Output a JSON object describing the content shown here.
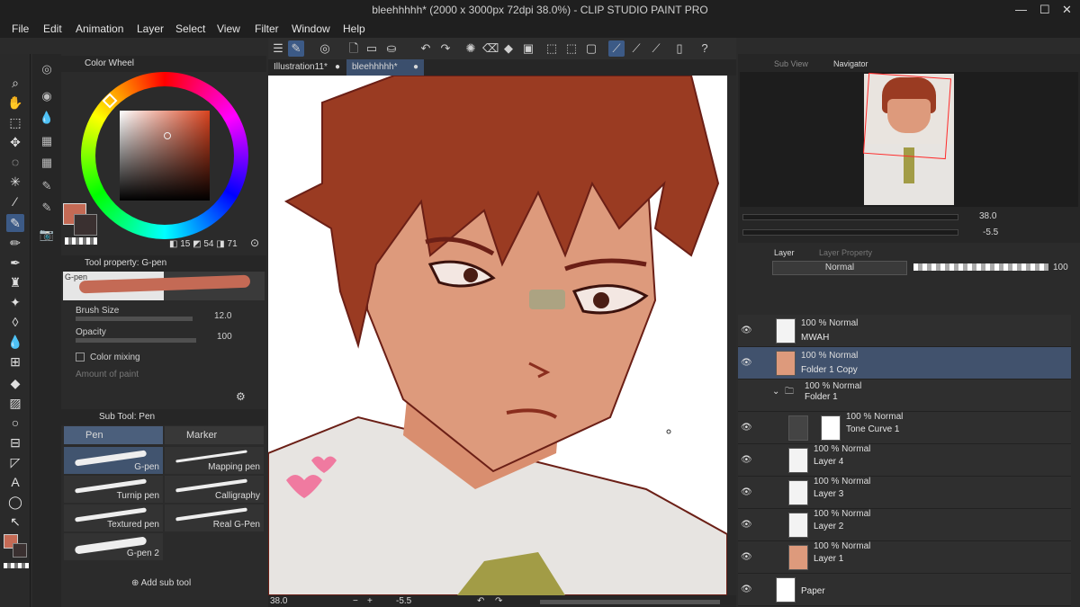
{
  "window": {
    "title": "bleehhhhh* (2000 x 3000px 72dpi 38.0%) - CLIP STUDIO PAINT PRO",
    "minimize": "—",
    "maximize": "☐",
    "close": "✕"
  },
  "menu": [
    "File",
    "Edit",
    "Animation",
    "Layer",
    "Select",
    "View",
    "Filter",
    "Window",
    "Help"
  ],
  "tabs": [
    {
      "label": "Illustration11*"
    },
    {
      "label": "bleehhhhh*"
    }
  ],
  "color_wheel": {
    "title": "Color Wheel",
    "h": "15",
    "s": "54",
    "v": "71",
    "main_color": "#c46a55",
    "sub_color": "#3a3030"
  },
  "tool_property": {
    "title": "Tool property: G-pen",
    "preview_label": "G-pen",
    "brush_size_label": "Brush Size",
    "brush_size_value": "12.0",
    "opacity_label": "Opacity",
    "opacity_value": "100",
    "color_mixing_label": "Color mixing",
    "amount_of_paint_label": "Amount of paint"
  },
  "sub_tool": {
    "title": "Sub Tool: Pen",
    "groups": [
      "Pen",
      "Marker"
    ],
    "items": [
      "G-pen",
      "Mapping pen",
      "Turnip pen",
      "Calligraphy",
      "Textured pen",
      "Real G-Pen",
      "G-pen 2"
    ],
    "add_label": "Add sub tool"
  },
  "navigator": {
    "subview_label": "Sub View",
    "navigator_label": "Navigator",
    "zoom": "38.0",
    "rotation": "-5.5"
  },
  "layer_panel": {
    "layer_tab": "Layer",
    "layer_property_tab": "Layer Property",
    "blend_mode": "Normal",
    "opacity": "100",
    "layers": [
      {
        "mode": "100 % Normal",
        "name": "MWAH"
      },
      {
        "mode": "100 % Normal",
        "name": "Folder 1 Copy"
      },
      {
        "mode": "100 % Normal",
        "name": "Folder 1"
      },
      {
        "mode": "100 % Normal",
        "name": "Tone Curve 1"
      },
      {
        "mode": "100 % Normal",
        "name": "Layer 4"
      },
      {
        "mode": "100 % Normal",
        "name": "Layer 3"
      },
      {
        "mode": "100 % Normal",
        "name": "Layer 2"
      },
      {
        "mode": "100 % Normal",
        "name": "Layer 1"
      },
      {
        "mode": "",
        "name": "Paper"
      }
    ]
  },
  "status": {
    "zoom": "38.0",
    "rotation": "-5.5"
  }
}
